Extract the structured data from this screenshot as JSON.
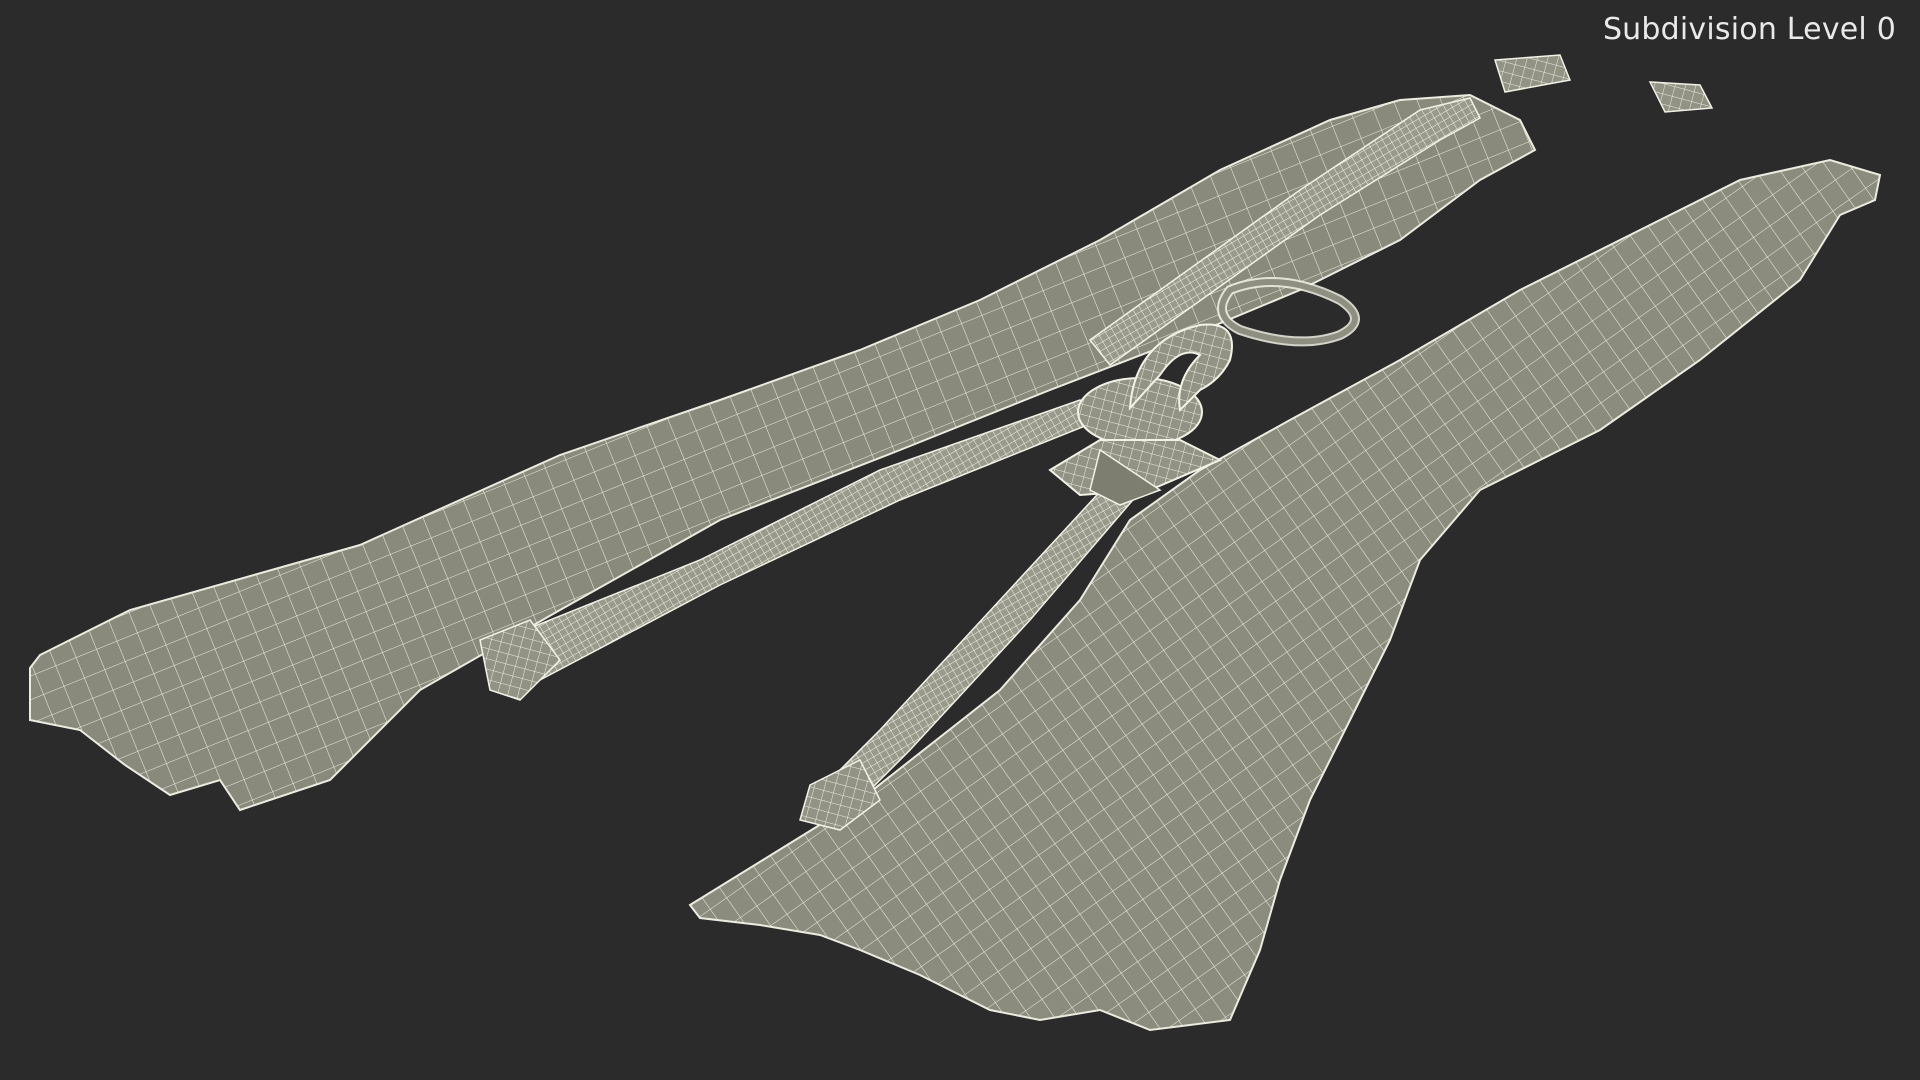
{
  "viewport": {
    "label": "Subdivision Level 0"
  },
  "colors": {
    "background": "#2b2b2b",
    "mesh_fill": "#8c8c7e",
    "mesh_fill_dark": "#6f6f63",
    "wire": "#ecebe0",
    "teeth": "#9a9a8c"
  },
  "model": {
    "subject": "zipper-wireframe",
    "parts": [
      "left-tape",
      "right-tape",
      "teeth-chain",
      "slider",
      "pull-tab",
      "top-stop",
      "bottom-stop"
    ]
  }
}
